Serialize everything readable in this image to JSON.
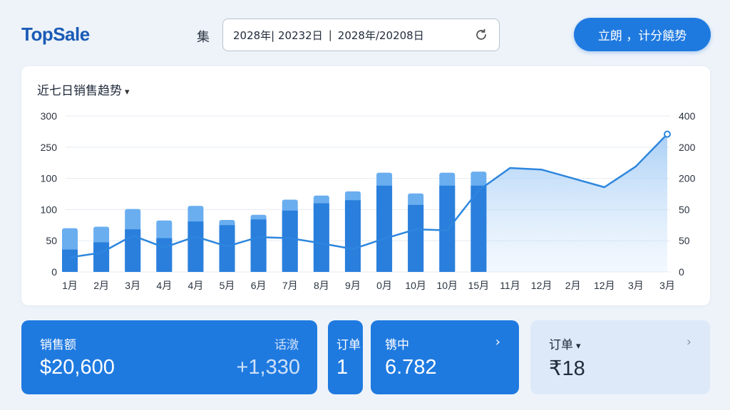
{
  "header": {
    "logo": "TopSale",
    "range_label": "集",
    "date_start": "2028年| 20232日",
    "date_sep": "|",
    "date_end": "2028年/20208日",
    "cta_label": "立朗 ，计分饒势"
  },
  "chart_card": {
    "title": "近七日销售趋势",
    "title_marker": "▾"
  },
  "chart_data": {
    "type": "bar",
    "categories": [
      "1月",
      "2月",
      "3月",
      "4月",
      "4月",
      "5月",
      "6月",
      "7月",
      "8月",
      "9月",
      "0月",
      "10月",
      "10月",
      "15月",
      "11月",
      "12月",
      "2月",
      "12月",
      "3月",
      "3月"
    ],
    "left_ticks": [
      "300",
      "250",
      "100",
      "100",
      "50",
      "0"
    ],
    "right_ticks": [
      "400",
      "200",
      "200",
      "50",
      "50",
      "0"
    ],
    "series": [
      {
        "values": [
          43,
          57,
          82,
          65,
          97,
          90,
          101,
          118,
          132,
          138,
          166,
          129,
          166,
          166,
          null,
          null,
          null,
          null,
          null,
          null
        ]
      },
      {
        "values": [
          84,
          87,
          121,
          99,
          127,
          100,
          110,
          139,
          147,
          155,
          191,
          151,
          191,
          193,
          null,
          null,
          null,
          null,
          null,
          null
        ]
      },
      {
        "values": [
          28,
          37,
          70,
          47,
          68,
          49,
          67,
          65,
          55,
          44,
          64,
          82,
          80,
          157,
          200,
          197,
          180,
          163,
          203,
          265
        ]
      }
    ],
    "ylim": [
      0,
      300
    ],
    "grid": true,
    "legend": "none"
  },
  "cards": {
    "sales": {
      "label": "销售额",
      "value": "$20,600",
      "sub_label": "话潡",
      "sub_value": "+1,330"
    },
    "orders_a": {
      "label": "订单",
      "value": "1"
    },
    "middle": {
      "label": "镌中",
      "value": "6.782",
      "chev": "›"
    },
    "orders_b": {
      "label": "订单",
      "marker": "▾",
      "value": "₹18",
      "chev": "›"
    }
  },
  "colors": {
    "accent": "#1f7ae0",
    "bar_dark": "#2a7fdc",
    "bar_light": "#6aaef0",
    "line": "#2d86de",
    "card_light": "#dde9f8"
  }
}
